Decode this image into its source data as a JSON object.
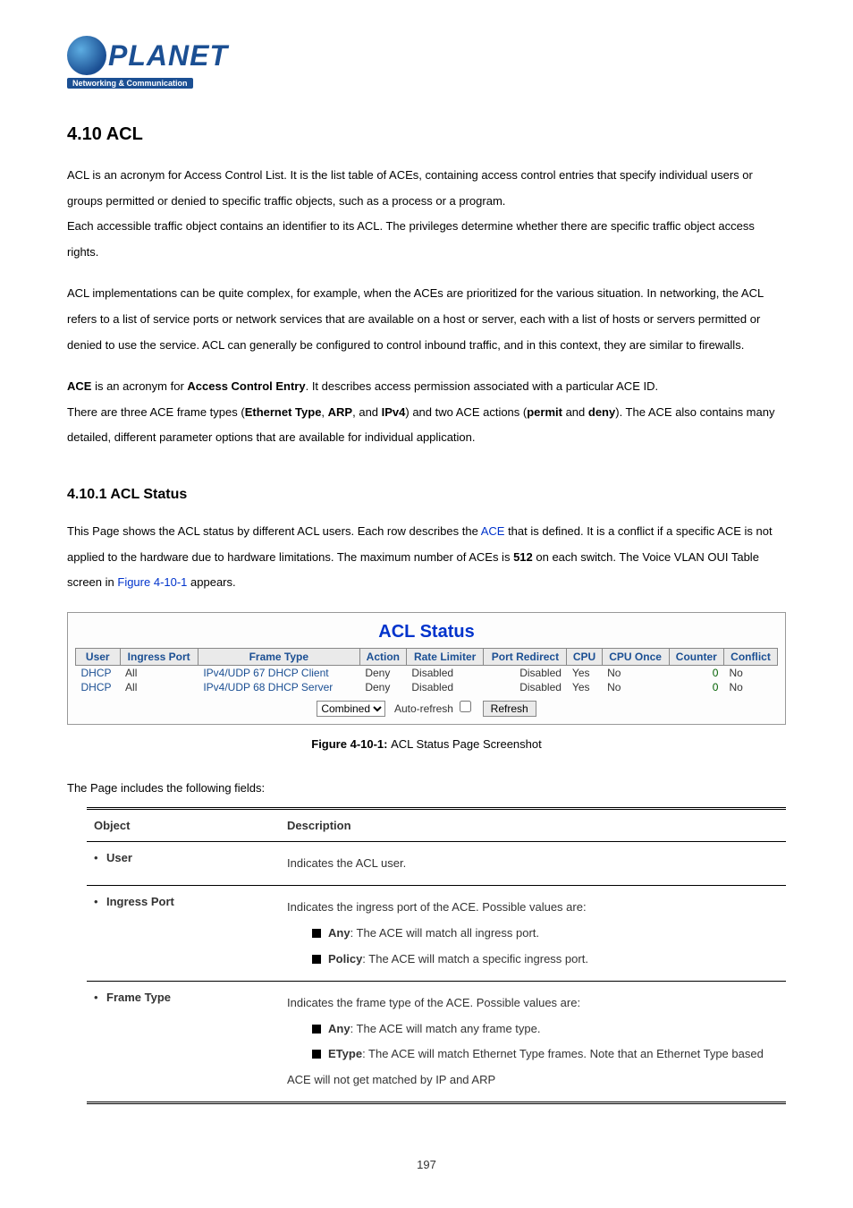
{
  "logo": {
    "brand": "PLANET",
    "tagline": "Networking & Communication"
  },
  "section": {
    "h1": "4.10 ACL",
    "p1": "ACL is an acronym for Access Control List. It is the list table of ACEs, containing access control entries that specify individual users or groups permitted or denied to specific traffic objects, such as a process or a program.",
    "p2": "Each accessible traffic object contains an identifier to its ACL. The privileges determine whether there are specific traffic object access rights.",
    "p3": "ACL implementations can be quite complex, for example, when the ACEs are prioritized for the various situation. In networking, the ACL refers to a list of service ports or network services that are available on a host or server, each with a list of hosts or servers permitted or denied to use the service. ACL can generally be configured to control inbound traffic, and in this context, they are similar to firewalls.",
    "ace_b1": "ACE",
    "ace_t1": " is an acronym for ",
    "ace_b2": "Access Control Entry",
    "ace_t2": ". It describes access permission associated with a particular ACE ID.",
    "ace_t3": "There are three ACE frame types (",
    "ace_b3": "Ethernet Type",
    "ace_c1": ", ",
    "ace_b4": "ARP",
    "ace_c2": ", and ",
    "ace_b5": "IPv4",
    "ace_t4": ") and two ACE actions (",
    "ace_b6": "permit",
    "ace_c3": " and ",
    "ace_b7": "deny",
    "ace_t5": "). The ACE also contains many detailed, different parameter options that are available for individual application.",
    "h2": "4.10.1 ACL Status",
    "p4a": "This Page shows the ACL status by different ACL users. Each row describes the ",
    "p4b": "ACE",
    "p4c": " that is defined. It is a conflict if a specific ACE is not applied to the hardware due to hardware limitations. The maximum number of ACEs is ",
    "p4d": "512",
    "p4e": " on each switch. The Voice VLAN OUI Table screen in ",
    "p4link": "Figure 4-10-1",
    "p4f": " appears."
  },
  "acl_panel": {
    "title": "ACL Status",
    "headers": [
      "User",
      "Ingress Port",
      "Frame Type",
      "Action",
      "Rate Limiter",
      "Port Redirect",
      "CPU",
      "CPU Once",
      "Counter",
      "Conflict"
    ],
    "rows": [
      {
        "user": "DHCP",
        "ingress": "All",
        "frame": "IPv4/UDP 67 DHCP Client",
        "action": "Deny",
        "rate": "Disabled",
        "redirect": "Disabled",
        "cpu": "Yes",
        "cpuonce": "No",
        "counter": "0",
        "conflict": "No"
      },
      {
        "user": "DHCP",
        "ingress": "All",
        "frame": "IPv4/UDP 68 DHCP Server",
        "action": "Deny",
        "rate": "Disabled",
        "redirect": "Disabled",
        "cpu": "Yes",
        "cpuonce": "No",
        "counter": "0",
        "conflict": "No"
      }
    ],
    "select_value": "Combined",
    "auto_label": "Auto-refresh",
    "refresh_label": "Refresh"
  },
  "caption": {
    "prefix": "Figure 4-10-1: ",
    "text": "ACL Status Page Screenshot"
  },
  "fields_intro": "The Page includes the following fields:",
  "fields": {
    "h_object": "Object",
    "h_desc": "Description",
    "r1_obj": "User",
    "r1_desc": "Indicates the ACL user.",
    "r2_obj": "Ingress Port",
    "r2_l1": "Indicates the ingress port of the ACE. Possible values are:",
    "r2_b1": "Any",
    "r2_b1t": ": The ACE will match all ingress port.",
    "r2_b2": "Policy",
    "r2_b2t": ": The ACE will match a specific ingress port.",
    "r3_obj": "Frame Type",
    "r3_l1": "Indicates the frame type of the ACE. Possible values are:",
    "r3_b1": "Any",
    "r3_b1t": ": The ACE will match any frame type.",
    "r3_b2": "EType",
    "r3_b2t": ": The ACE will match Ethernet Type frames. Note that an Ethernet Type based ACE will not get matched by IP and ARP"
  },
  "pagenum": "197"
}
